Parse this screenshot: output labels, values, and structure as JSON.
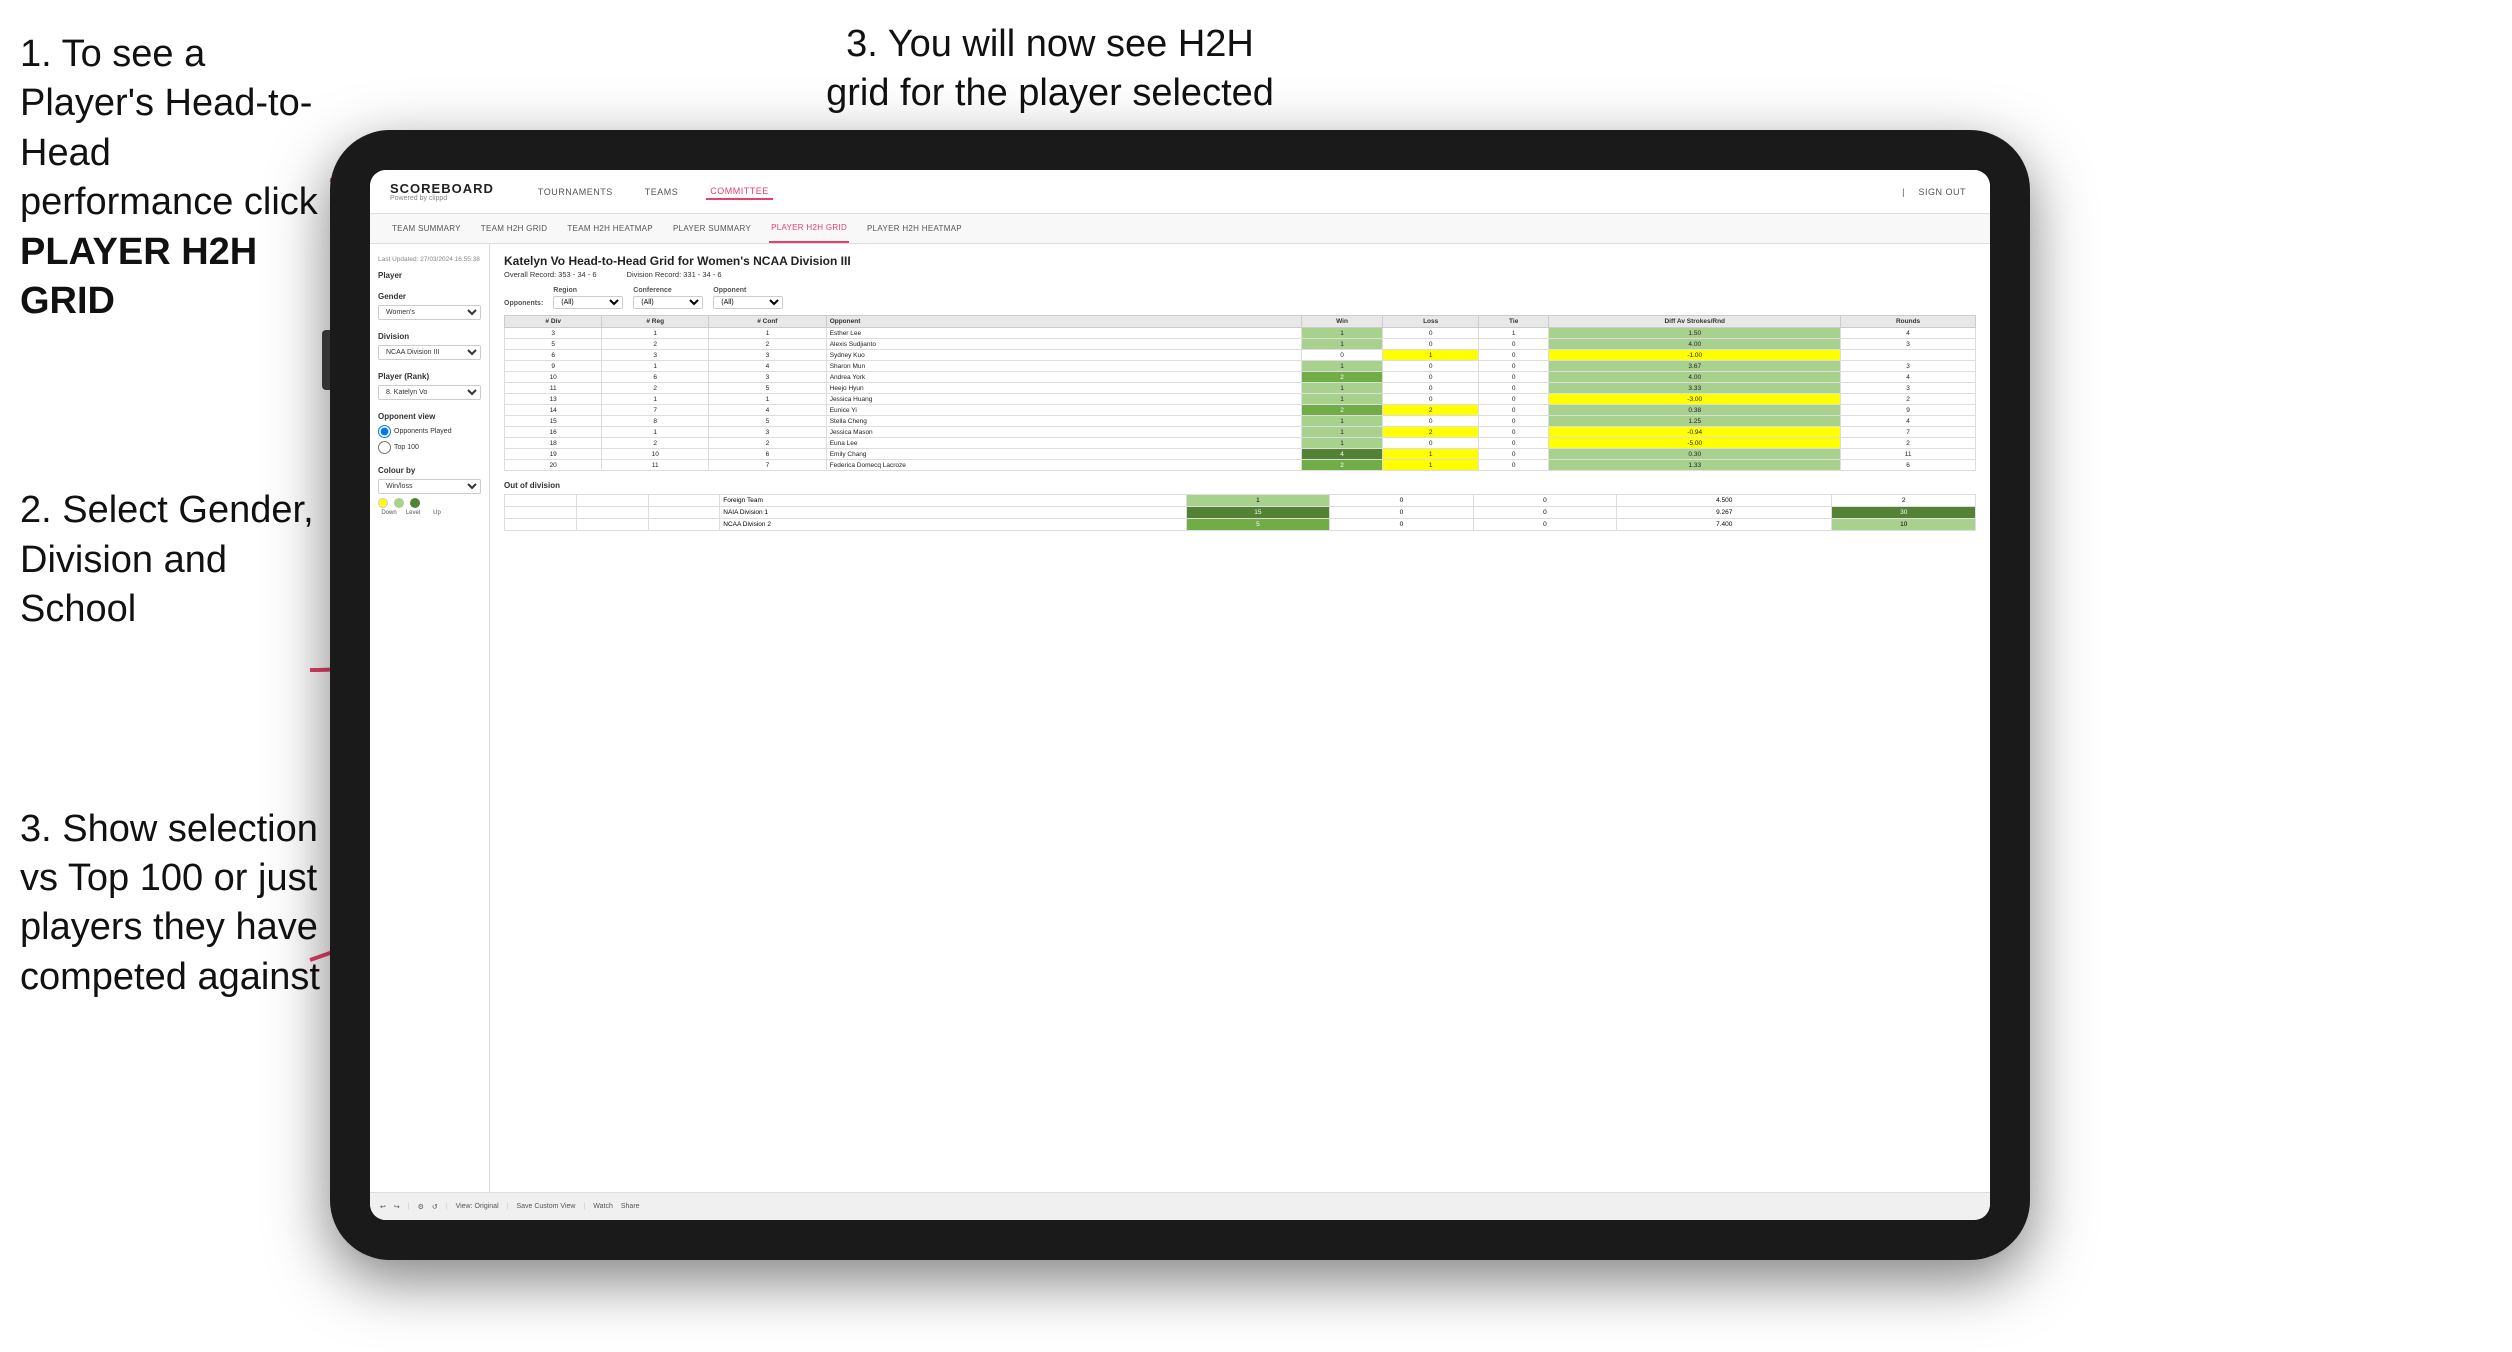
{
  "instructions": {
    "step1": "1. To see a Player's Head-to-Head performance click",
    "step1_bold": "PLAYER H2H GRID",
    "step2_title": "2. Select Gender, Division and School",
    "step3_left": "3. Show selection vs Top 100 or just players they have competed against",
    "step3_right": "3. You will now see H2H grid for the player selected"
  },
  "nav": {
    "logo": "SCOREBOARD",
    "logo_sub": "Powered by clippd",
    "items": [
      "TOURNAMENTS",
      "TEAMS",
      "COMMITTEE"
    ],
    "sign_out": "Sign out"
  },
  "sub_nav": {
    "items": [
      "TEAM SUMMARY",
      "TEAM H2H GRID",
      "TEAM H2H HEATMAP",
      "PLAYER SUMMARY",
      "PLAYER H2H GRID",
      "PLAYER H2H HEATMAP"
    ]
  },
  "sidebar": {
    "timestamp": "Last Updated: 27/03/2024 16:55:38",
    "player_label": "Player",
    "gender_label": "Gender",
    "gender_value": "Women's",
    "division_label": "Division",
    "division_value": "NCAA Division III",
    "player_rank_label": "Player (Rank)",
    "player_rank_value": "8. Katelyn Vo",
    "opponent_view_label": "Opponent view",
    "opponent_played": "Opponents Played",
    "top_100": "Top 100",
    "colour_label": "Colour by",
    "colour_value": "Win/loss",
    "colour_dots": [
      "yellow",
      "#a9d18e",
      "#548235"
    ],
    "colour_labels": [
      "Down",
      "Level",
      "Up"
    ]
  },
  "grid": {
    "title": "Katelyn Vo Head-to-Head Grid for Women's NCAA Division III",
    "overall_record": "Overall Record: 353 - 34 - 6",
    "division_record": "Division Record: 331 - 34 - 6",
    "filter_opponents_label": "Opponents:",
    "filter_region_label": "Region",
    "filter_conference_label": "Conference",
    "filter_opponent_label": "Opponent",
    "filter_all": "(All)",
    "columns": [
      "# Div",
      "# Reg",
      "# Conf",
      "Opponent",
      "Win",
      "Loss",
      "Tie",
      "Diff Av Strokes/Rnd",
      "Rounds"
    ],
    "rows": [
      {
        "div": 3,
        "reg": 1,
        "conf": 1,
        "name": "Esther Lee",
        "win": 1,
        "loss": 0,
        "tie": 1,
        "diff": "1.50",
        "rounds": 4,
        "win_color": "green-light",
        "loss_color": "white-bg",
        "tie_color": "white-bg",
        "diff_color": "green-light"
      },
      {
        "div": 5,
        "reg": 2,
        "conf": 2,
        "name": "Alexis Sudjianto",
        "win": 1,
        "loss": 0,
        "tie": 0,
        "diff": "4.00",
        "rounds": 3,
        "win_color": "green-light",
        "loss_color": "white-bg",
        "tie_color": "white-bg",
        "diff_color": "green-light"
      },
      {
        "div": 6,
        "reg": 3,
        "conf": 3,
        "name": "Sydney Kuo",
        "win": 0,
        "loss": 1,
        "tie": 0,
        "diff": "-1.00",
        "rounds": "",
        "win_color": "white-bg",
        "loss_color": "yellow",
        "tie_color": "white-bg",
        "diff_color": "yellow"
      },
      {
        "div": 9,
        "reg": 1,
        "conf": 4,
        "name": "Sharon Mun",
        "win": 1,
        "loss": 0,
        "tie": 0,
        "diff": "3.67",
        "rounds": 3,
        "win_color": "green-light",
        "loss_color": "white-bg",
        "tie_color": "white-bg",
        "diff_color": "green-light"
      },
      {
        "div": 10,
        "reg": 6,
        "conf": 3,
        "name": "Andrea York",
        "win": 2,
        "loss": 0,
        "tie": 0,
        "diff": "4.00",
        "rounds": 4,
        "win_color": "green-med",
        "loss_color": "white-bg",
        "tie_color": "white-bg",
        "diff_color": "green-light"
      },
      {
        "div": 11,
        "reg": 2,
        "conf": 5,
        "name": "Heejo Hyun",
        "win": 1,
        "loss": 0,
        "tie": 0,
        "diff": "3.33",
        "rounds": 3,
        "win_color": "green-light",
        "loss_color": "white-bg",
        "tie_color": "white-bg",
        "diff_color": "green-light"
      },
      {
        "div": 13,
        "reg": 1,
        "conf": 1,
        "name": "Jessica Huang",
        "win": 1,
        "loss": 0,
        "tie": 0,
        "diff": "-3.00",
        "rounds": 2,
        "win_color": "green-light",
        "loss_color": "white-bg",
        "tie_color": "white-bg",
        "diff_color": "yellow"
      },
      {
        "div": 14,
        "reg": 7,
        "conf": 4,
        "name": "Eunice Yi",
        "win": 2,
        "loss": 2,
        "tie": 0,
        "diff": "0.38",
        "rounds": 9,
        "win_color": "green-med",
        "loss_color": "yellow",
        "tie_color": "white-bg",
        "diff_color": "green-light"
      },
      {
        "div": 15,
        "reg": 8,
        "conf": 5,
        "name": "Stella Cheng",
        "win": 1,
        "loss": 0,
        "tie": 0,
        "diff": "1.25",
        "rounds": 4,
        "win_color": "green-light",
        "loss_color": "white-bg",
        "tie_color": "white-bg",
        "diff_color": "green-light"
      },
      {
        "div": 16,
        "reg": 1,
        "conf": 3,
        "name": "Jessica Mason",
        "win": 1,
        "loss": 2,
        "tie": 0,
        "diff": "-0.94",
        "rounds": 7,
        "win_color": "green-light",
        "loss_color": "yellow",
        "tie_color": "white-bg",
        "diff_color": "yellow"
      },
      {
        "div": 18,
        "reg": 2,
        "conf": 2,
        "name": "Euna Lee",
        "win": 1,
        "loss": 0,
        "tie": 0,
        "diff": "-5.00",
        "rounds": 2,
        "win_color": "green-light",
        "loss_color": "white-bg",
        "tie_color": "white-bg",
        "diff_color": "yellow"
      },
      {
        "div": 19,
        "reg": 10,
        "conf": 6,
        "name": "Emily Chang",
        "win": 4,
        "loss": 1,
        "tie": 0,
        "diff": "0.30",
        "rounds": 11,
        "win_color": "green-dark",
        "loss_color": "yellow",
        "tie_color": "white-bg",
        "diff_color": "green-light"
      },
      {
        "div": 20,
        "reg": 11,
        "conf": 7,
        "name": "Federica Domecq Lacroze",
        "win": 2,
        "loss": 1,
        "tie": 0,
        "diff": "1.33",
        "rounds": 6,
        "win_color": "green-med",
        "loss_color": "yellow",
        "tie_color": "white-bg",
        "diff_color": "green-light"
      }
    ],
    "ood_title": "Out of division",
    "ood_rows": [
      {
        "name": "Foreign Team",
        "win": 1,
        "loss": 0,
        "tie": 0,
        "diff": "4.500",
        "rounds": 2,
        "win_color": "green-light",
        "loss_color": "white-bg",
        "rounds_color": "white-bg"
      },
      {
        "name": "NAIA Division 1",
        "win": 15,
        "loss": 0,
        "tie": 0,
        "diff": "9.267",
        "rounds": 30,
        "win_color": "green-dark",
        "loss_color": "white-bg",
        "rounds_color": "green-dark"
      },
      {
        "name": "NCAA Division 2",
        "win": 5,
        "loss": 0,
        "tie": 0,
        "diff": "7.400",
        "rounds": 10,
        "win_color": "green-med",
        "loss_color": "white-bg",
        "rounds_color": "green-light"
      }
    ]
  },
  "toolbar": {
    "view_original": "View: Original",
    "save_custom": "Save Custom View",
    "watch": "Watch",
    "share": "Share"
  }
}
